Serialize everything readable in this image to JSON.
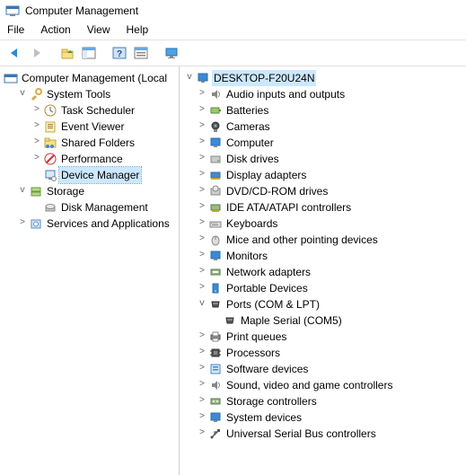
{
  "window": {
    "title": "Computer Management"
  },
  "menu": {
    "file": "File",
    "action": "Action",
    "view": "View",
    "help": "Help"
  },
  "left_tree": {
    "root": "Computer Management (Local",
    "system_tools": "System Tools",
    "task_scheduler": "Task Scheduler",
    "event_viewer": "Event Viewer",
    "shared_folders": "Shared Folders",
    "performance": "Performance",
    "device_manager": "Device Manager",
    "storage": "Storage",
    "disk_management": "Disk Management",
    "services_apps": "Services and Applications"
  },
  "right_tree": {
    "computer_name": "DESKTOP-F20U24N",
    "audio": "Audio inputs and outputs",
    "batteries": "Batteries",
    "cameras": "Cameras",
    "computer": "Computer",
    "disk_drives": "Disk drives",
    "display_adapters": "Display adapters",
    "dvd": "DVD/CD-ROM drives",
    "ide": "IDE ATA/ATAPI controllers",
    "keyboards": "Keyboards",
    "mice": "Mice and other pointing devices",
    "monitors": "Monitors",
    "network": "Network adapters",
    "portable": "Portable Devices",
    "ports": "Ports (COM & LPT)",
    "maple_serial": "Maple Serial (COM5)",
    "print_queues": "Print queues",
    "processors": "Processors",
    "software_devices": "Software devices",
    "sound": "Sound, video and game controllers",
    "storage_ctrl": "Storage controllers",
    "system_devices": "System devices",
    "usb": "Universal Serial Bus controllers"
  }
}
